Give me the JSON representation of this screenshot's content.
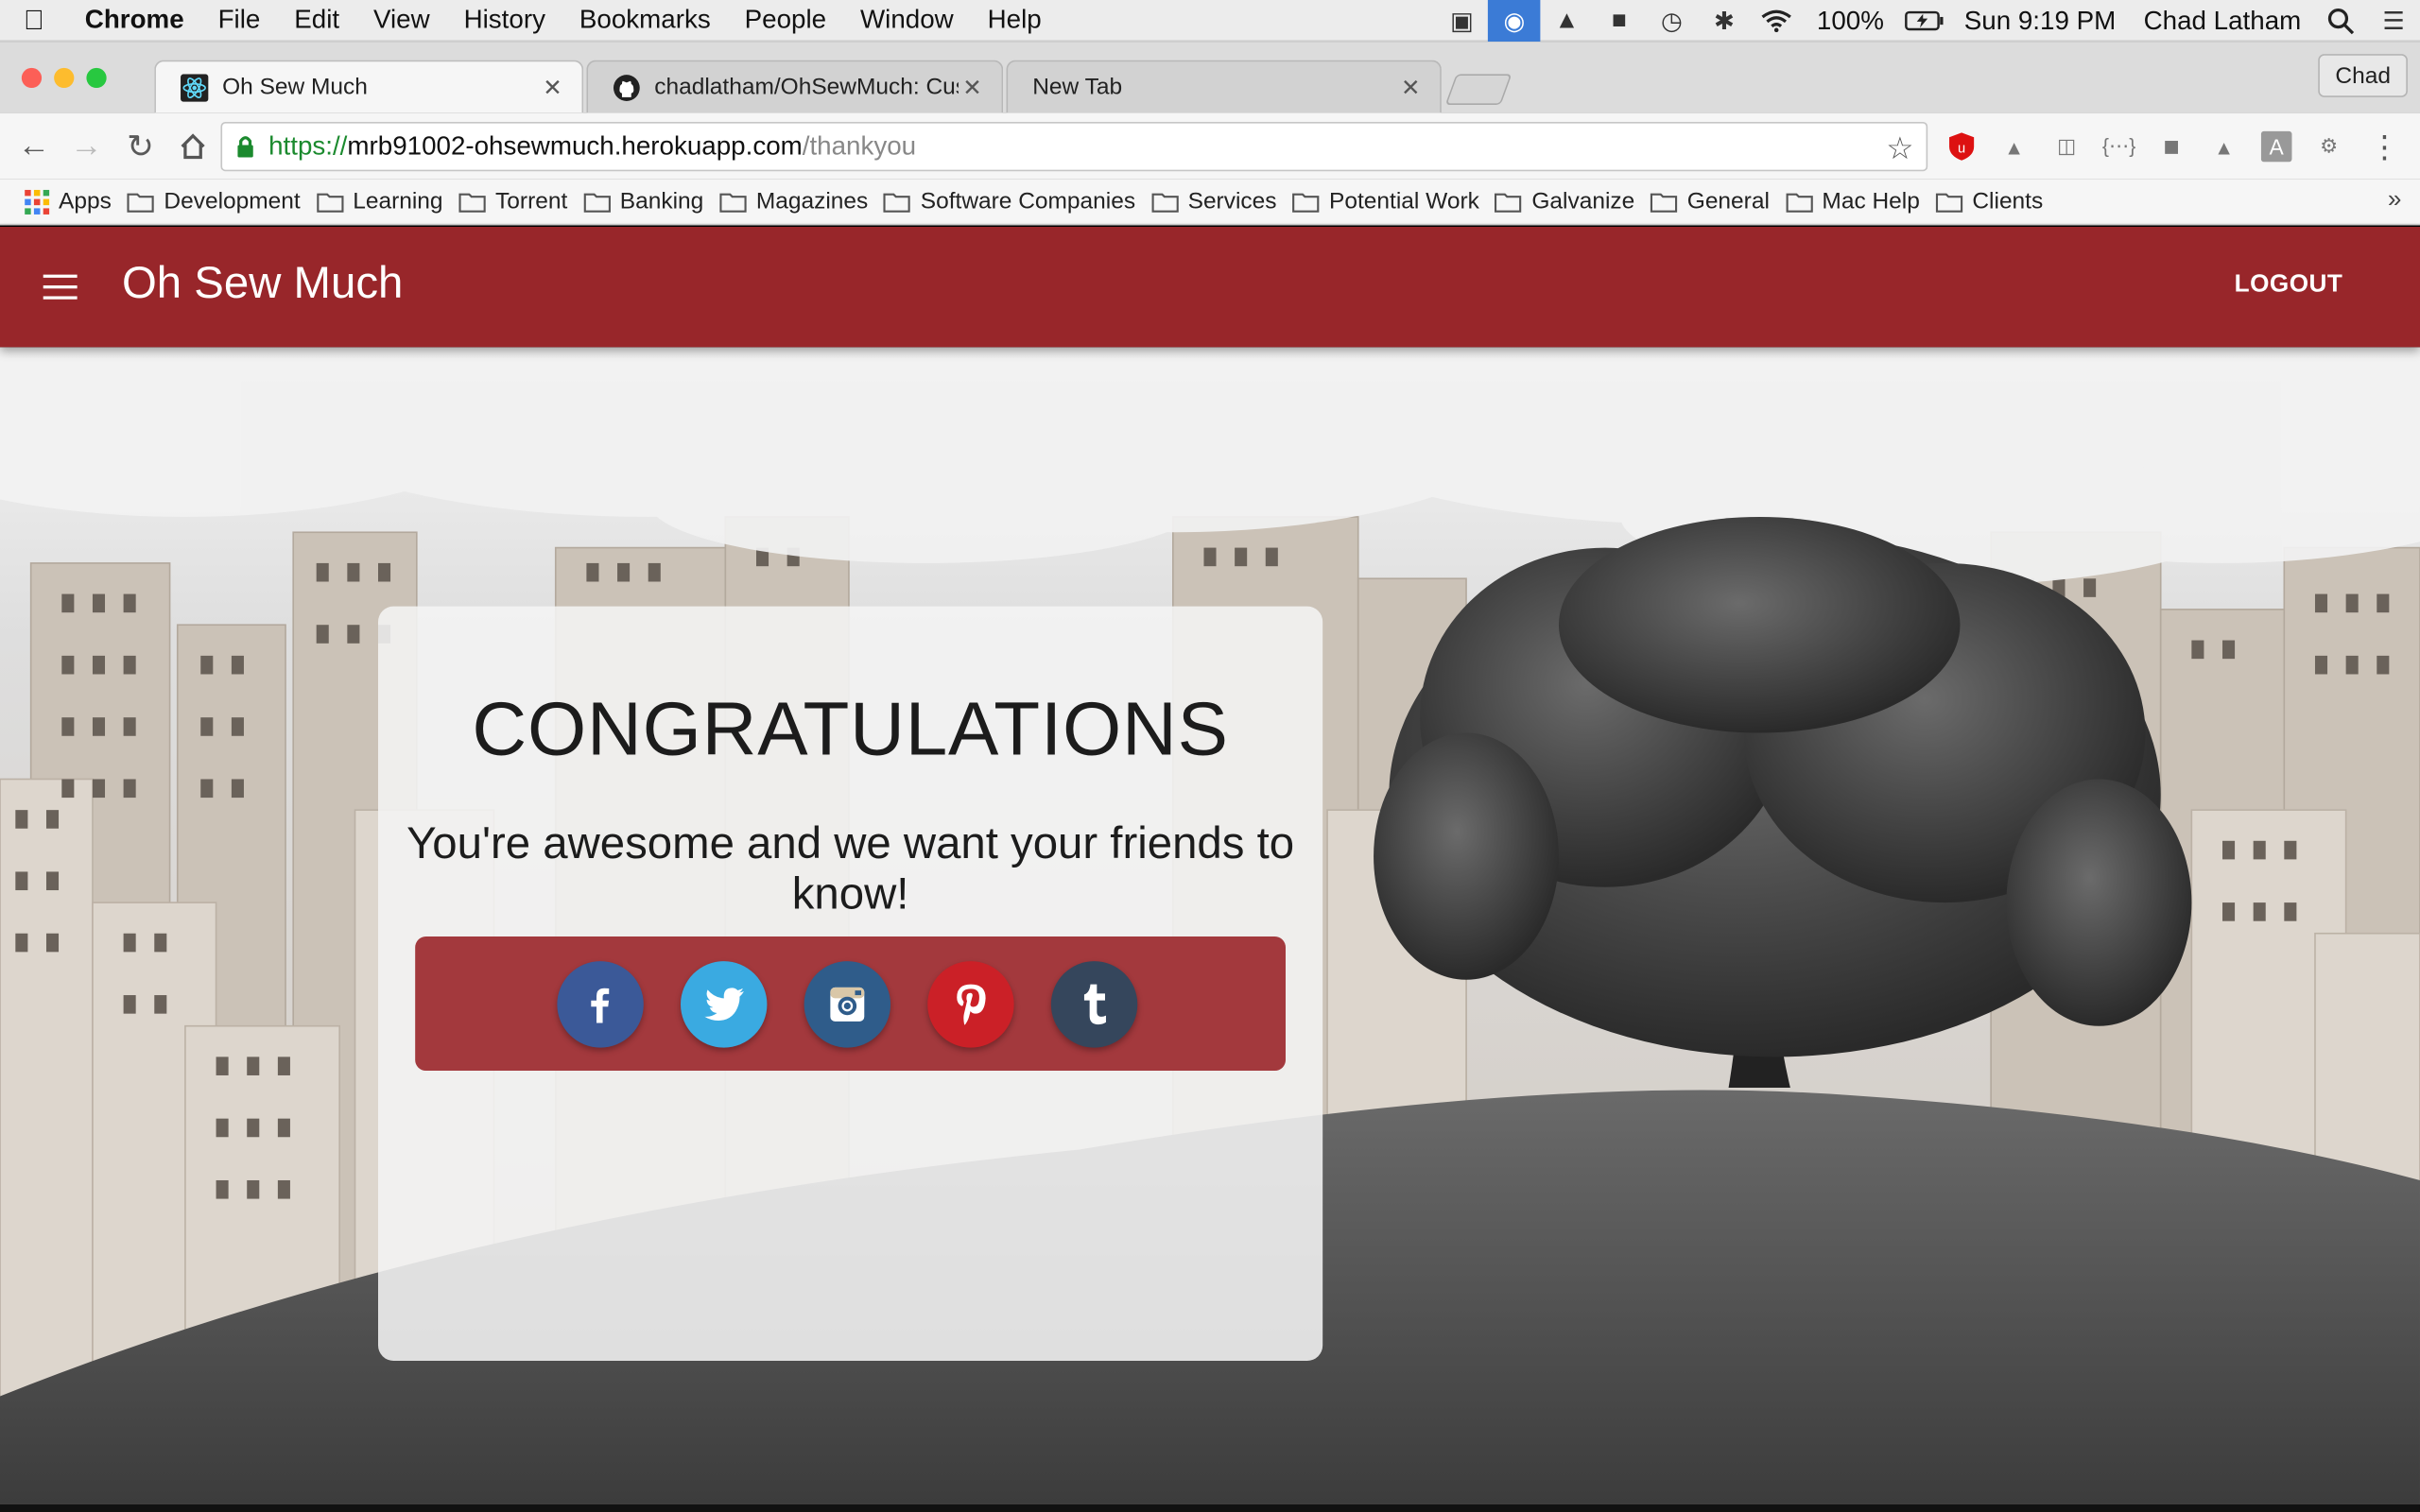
{
  "menubar": {
    "app_name": "Chrome",
    "menus": [
      "File",
      "Edit",
      "View",
      "History",
      "Bookmarks",
      "People",
      "Window",
      "Help"
    ],
    "battery": "100%",
    "clock": "Sun 9:19 PM",
    "user": "Chad Latham"
  },
  "tabs": [
    {
      "title": "Oh Sew Much",
      "icon": "react-icon",
      "active": true
    },
    {
      "title": "chadlatham/OhSewMuch: Cust",
      "icon": "github-icon",
      "active": false
    },
    {
      "title": "New Tab",
      "icon": "",
      "active": false
    }
  ],
  "profile": "Chad",
  "address": {
    "scheme": "https://",
    "host": "mrb91002-ohsewmuch.herokuapp.com",
    "path": "/thankyou"
  },
  "bookmarks": [
    "Apps",
    "Development",
    "Learning",
    "Torrent",
    "Banking",
    "Magazines",
    "Software Companies",
    "Services",
    "Potential Work",
    "Galvanize",
    "General",
    "Mac Help",
    "Clients"
  ],
  "app": {
    "title": "Oh Sew Much",
    "logout": "LOGOUT",
    "accent": "#98262a"
  },
  "card": {
    "heading": "CONGRATULATIONS",
    "message": "You're awesome and we want your friends to know!",
    "share_bar_color": "#a3393d",
    "social": [
      {
        "name": "facebook",
        "color": "#3b5998"
      },
      {
        "name": "twitter",
        "color": "#3aaae1"
      },
      {
        "name": "instagram",
        "color": "#2f5c8a"
      },
      {
        "name": "pinterest",
        "color": "#cb2027"
      },
      {
        "name": "tumblr",
        "color": "#35465c"
      }
    ]
  }
}
